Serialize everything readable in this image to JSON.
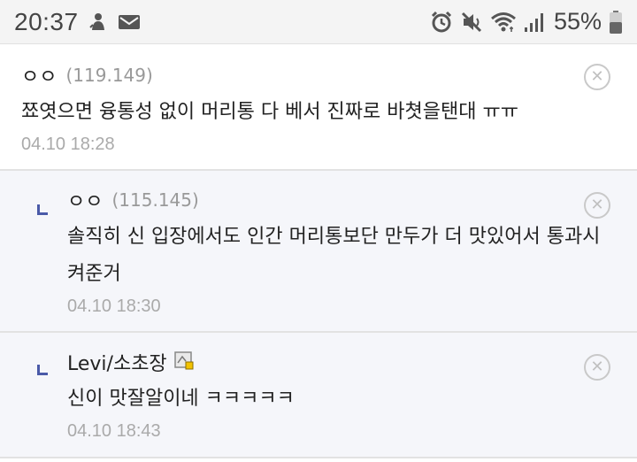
{
  "status_bar": {
    "time": "20:37",
    "battery_percent": "55%"
  },
  "comments": [
    {
      "nickname": "ㅇㅇ",
      "ip": "(119.149)",
      "text": "쬬엿으면 융통성 없이 머리통 다 베서 진짜로 바쳣을탠대 ㅠㅠ",
      "date": "04.10 18:28",
      "delete_icon": "close-circle-icon"
    },
    {
      "nickname": "ㅇㅇ",
      "ip": "(115.145)",
      "text": "솔직히 신 입장에서도 인간 머리통보단 만두가 더 맛있어서 통과시켜준거",
      "date": "04.10 18:30",
      "delete_icon": "close-circle-icon"
    },
    {
      "nickname": "Levi/소초장",
      "text": "신이 맛잘알이네 ㅋㅋㅋㅋㅋ",
      "date": "04.10 18:43",
      "delete_icon": "close-circle-icon"
    }
  ]
}
